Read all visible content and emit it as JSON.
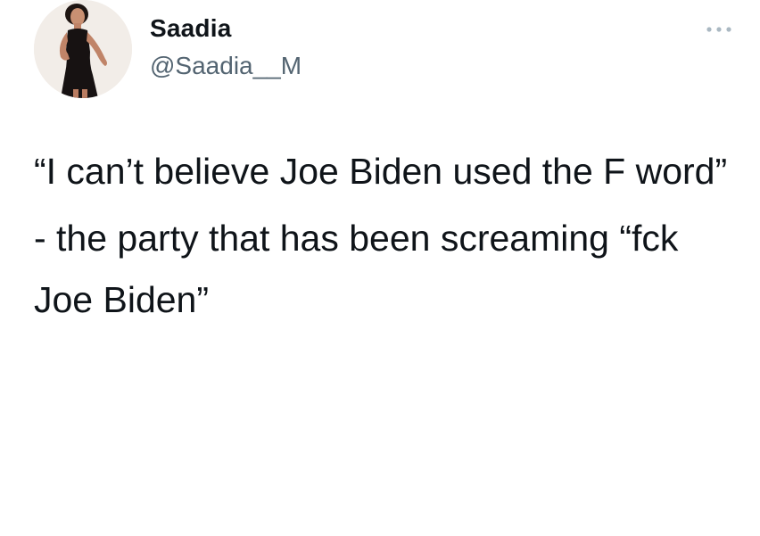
{
  "author": {
    "display_name": "Saadia",
    "handle": "@Saadia__M",
    "avatar_icon": "profile-photo"
  },
  "menu": {
    "icon": "more-icon"
  },
  "tweet": {
    "paragraphs": [
      "“I can’t believe Joe Biden used the F word”",
      "- the party that has been screaming “fck Joe Biden”"
    ]
  },
  "colors": {
    "text": "#0f1419",
    "secondary_text": "#536471",
    "background": "#ffffff"
  }
}
